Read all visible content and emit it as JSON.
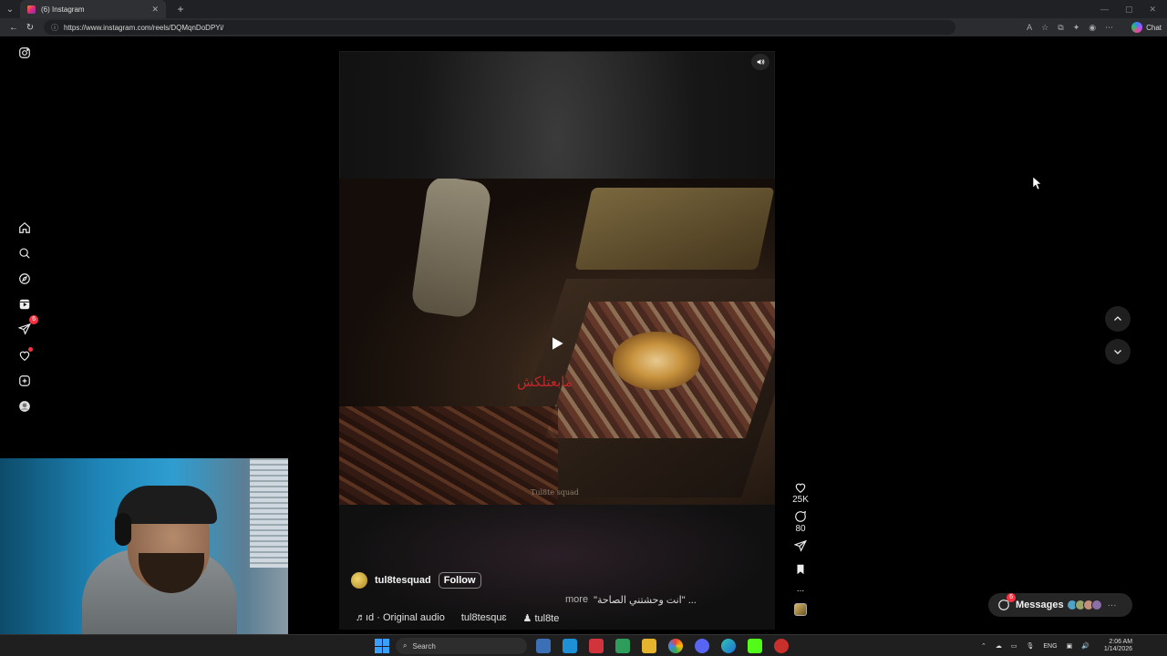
{
  "browser": {
    "tab_title": "(6) Instagram",
    "tab_close": "✕",
    "new_tab": "+",
    "url": "https://www.instagram.com/reels/DQMqnDoDPYi/",
    "chat_label": "Chat"
  },
  "sidebar": {
    "messages_badge": "6"
  },
  "reel": {
    "video_caption": "مابعتلكش",
    "watermark": "Tul8te squad",
    "author": "tul8tesquad",
    "follow_label": "Follow",
    "caption_text": "\"انت وحشتني الصاحة\" ...",
    "caption_more": "more",
    "audio_label": "♬ıd · Original audio",
    "audio_user": "tul8tesquɛ",
    "tagged_user": "♟ tul8te",
    "likes": "25K",
    "comments": "80",
    "more_dots": "..."
  },
  "messages": {
    "label": "Messages",
    "badge": "6",
    "dots": "···"
  },
  "taskbar": {
    "search_label": "Search",
    "lang": "ENG",
    "time": "2:06 AM",
    "date": "1/14/2026"
  },
  "colors": {
    "accent_red": "#ff3040",
    "video_caption_red": "#c0282a"
  }
}
